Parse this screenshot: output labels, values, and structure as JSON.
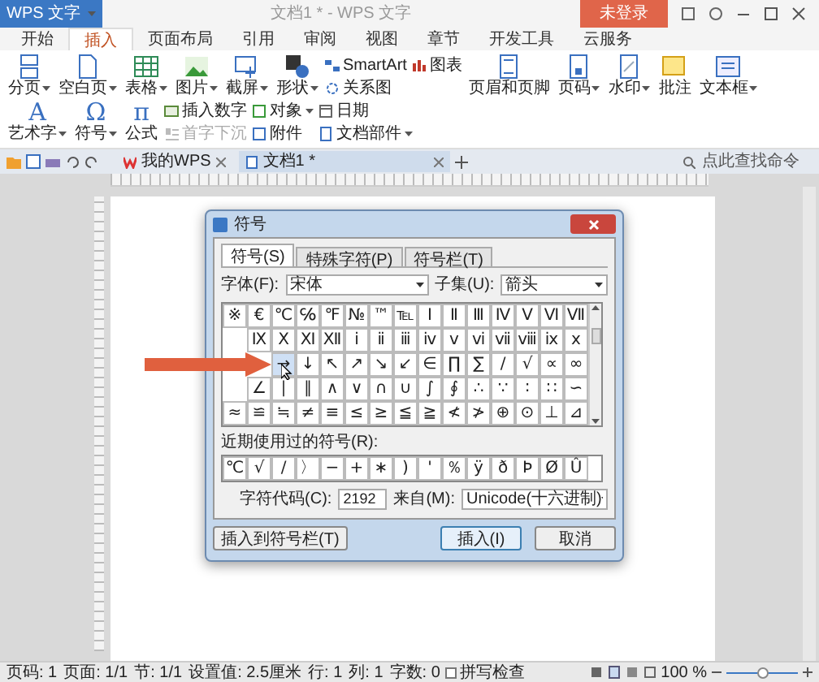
{
  "title_bar": {
    "app_menu": "WPS 文字",
    "title": "文档1 * - WPS 文字",
    "login": "未登录"
  },
  "menu_tabs": [
    {
      "label": "开始",
      "selected": false
    },
    {
      "label": "插入",
      "selected": true
    },
    {
      "label": "页面布局",
      "selected": false
    },
    {
      "label": "引用",
      "selected": false
    },
    {
      "label": "审阅",
      "selected": false
    },
    {
      "label": "视图",
      "selected": false
    },
    {
      "label": "章节",
      "selected": false
    },
    {
      "label": "开发工具",
      "selected": false
    },
    {
      "label": "云服务",
      "selected": false
    }
  ],
  "ribbon": [
    {
      "kind": "large",
      "label": "分页",
      "dropdown": true
    },
    {
      "kind": "large",
      "label": "空白页",
      "dropdown": true
    },
    {
      "kind": "large",
      "label": "表格",
      "dropdown": true
    },
    {
      "kind": "large",
      "label": "图片",
      "dropdown": true
    },
    {
      "kind": "large",
      "label": "截屏",
      "dropdown": true
    },
    {
      "kind": "large",
      "label": "形状",
      "dropdown": true
    },
    {
      "kind": "stack",
      "items": [
        {
          "label": "SmartArt",
          "dropdown": false,
          "disabled": false
        },
        {
          "label": "关系图",
          "dropdown": false,
          "disabled": false
        }
      ]
    },
    {
      "kind": "stack",
      "items": [
        {
          "label": "图表",
          "dropdown": false,
          "disabled": false
        }
      ]
    },
    {
      "kind": "large",
      "label": "页眉和页脚",
      "dropdown": false
    },
    {
      "kind": "large",
      "label": "页码",
      "dropdown": true
    },
    {
      "kind": "large",
      "label": "水印",
      "dropdown": true
    },
    {
      "kind": "large",
      "label": "批注",
      "dropdown": false
    },
    {
      "kind": "large",
      "label": "文本框",
      "dropdown": true
    },
    {
      "kind": "large",
      "label": "艺术字",
      "dropdown": true,
      "glyph": "A"
    },
    {
      "kind": "large",
      "label": "符号",
      "dropdown": true,
      "glyph": "Ω"
    },
    {
      "kind": "large",
      "label": "公式",
      "dropdown": false,
      "glyph": "π"
    },
    {
      "kind": "stack",
      "items": [
        {
          "label": "插入数字",
          "dropdown": false,
          "disabled": false
        },
        {
          "label": "首字下沉",
          "dropdown": false,
          "disabled": true
        }
      ]
    },
    {
      "kind": "stack",
      "items": [
        {
          "label": "对象",
          "dropdown": true,
          "disabled": false
        },
        {
          "label": "附件",
          "dropdown": false,
          "disabled": false
        }
      ]
    },
    {
      "kind": "stack",
      "items": [
        {
          "label": "日期",
          "dropdown": false,
          "disabled": false
        },
        {
          "label": "文档部件",
          "dropdown": true,
          "disabled": false
        }
      ]
    }
  ],
  "doc_tabs": [
    {
      "label": "我的WPS",
      "selected": false
    },
    {
      "label": "文档1 *",
      "selected": true
    }
  ],
  "command_search": {
    "placeholder": "点此查找命令"
  },
  "dialog": {
    "title": "符号",
    "tabs": [
      {
        "label": "符号(S)",
        "selected": true
      },
      {
        "label": "特殊字符(P)",
        "selected": false
      },
      {
        "label": "符号栏(T)",
        "selected": false
      }
    ],
    "font_label": "字体(F):",
    "font": "宋体",
    "subset_label": "子集(U):",
    "subset": "箭头",
    "grid": [
      [
        {
          "symbol": "※",
          "selected": false
        },
        {
          "symbol": "€",
          "selected": false
        },
        {
          "symbol": "℃",
          "selected": false
        },
        {
          "symbol": "℅",
          "selected": false
        },
        {
          "symbol": "℉",
          "selected": false
        },
        {
          "symbol": "№",
          "selected": false
        },
        {
          "symbol": "™",
          "selected": false
        },
        {
          "symbol": "℡",
          "selected": false
        },
        {
          "symbol": "Ⅰ",
          "selected": false
        },
        {
          "symbol": "Ⅱ",
          "selected": false
        },
        {
          "symbol": "Ⅲ",
          "selected": false
        },
        {
          "symbol": "Ⅳ",
          "selected": false
        },
        {
          "symbol": "Ⅴ",
          "selected": false
        },
        {
          "symbol": "Ⅵ",
          "selected": false
        },
        {
          "symbol": "Ⅶ",
          "selected": false
        }
      ],
      [
        {
          "symbol": "Ⅸ",
          "selected": false
        },
        {
          "symbol": "Ⅹ",
          "selected": false
        },
        {
          "symbol": "Ⅺ",
          "selected": false
        },
        {
          "symbol": "Ⅻ",
          "selected": false
        },
        {
          "symbol": "ⅰ",
          "selected": false
        },
        {
          "symbol": "ⅱ",
          "selected": false
        },
        {
          "symbol": "ⅲ",
          "selected": false
        },
        {
          "symbol": "ⅳ",
          "selected": false
        },
        {
          "symbol": "ⅴ",
          "selected": false
        },
        {
          "symbol": "ⅵ",
          "selected": false
        },
        {
          "symbol": "ⅶ",
          "selected": false
        },
        {
          "symbol": "ⅷ",
          "selected": false
        },
        {
          "symbol": "ⅸ",
          "selected": false
        },
        {
          "symbol": "ⅹ",
          "selected": false
        }
      ],
      [
        {
          "symbol": "→",
          "selected": true
        },
        {
          "symbol": "↓",
          "selected": false
        },
        {
          "symbol": "↖",
          "selected": false
        },
        {
          "symbol": "↗",
          "selected": false
        },
        {
          "symbol": "↘",
          "selected": false
        },
        {
          "symbol": "↙",
          "selected": false
        },
        {
          "symbol": "∈",
          "selected": false
        },
        {
          "symbol": "∏",
          "selected": false
        },
        {
          "symbol": "∑",
          "selected": false
        },
        {
          "symbol": "∕",
          "selected": false
        },
        {
          "symbol": "√",
          "selected": false
        },
        {
          "symbol": "∝",
          "selected": false
        },
        {
          "symbol": "∞",
          "selected": false
        }
      ],
      [
        {
          "symbol": "∠",
          "selected": false
        },
        {
          "symbol": "∣",
          "selected": false
        },
        {
          "symbol": "∥",
          "selected": false
        },
        {
          "symbol": "∧",
          "selected": false
        },
        {
          "symbol": "∨",
          "selected": false
        },
        {
          "symbol": "∩",
          "selected": false
        },
        {
          "symbol": "∪",
          "selected": false
        },
        {
          "symbol": "∫",
          "selected": false
        },
        {
          "symbol": "∮",
          "selected": false
        },
        {
          "symbol": "∴",
          "selected": false
        },
        {
          "symbol": "∵",
          "selected": false
        },
        {
          "symbol": "∶",
          "selected": false
        },
        {
          "symbol": "∷",
          "selected": false
        },
        {
          "symbol": "∽",
          "selected": false
        }
      ],
      [
        {
          "symbol": "≈",
          "selected": false
        },
        {
          "symbol": "≌",
          "selected": false
        },
        {
          "symbol": "≒",
          "selected": false
        },
        {
          "symbol": "≠",
          "selected": false
        },
        {
          "symbol": "≡",
          "selected": false
        },
        {
          "symbol": "≤",
          "selected": false
        },
        {
          "symbol": "≥",
          "selected": false
        },
        {
          "symbol": "≦",
          "selected": false
        },
        {
          "symbol": "≧",
          "selected": false
        },
        {
          "symbol": "≮",
          "selected": false
        },
        {
          "symbol": "≯",
          "selected": false
        },
        {
          "symbol": "⊕",
          "selected": false
        },
        {
          "symbol": "⊙",
          "selected": false
        },
        {
          "symbol": "⊥",
          "selected": false
        },
        {
          "symbol": "⊿",
          "selected": false
        }
      ]
    ],
    "recent_label": "近期使用过的符号(R):",
    "recent": [
      "℃",
      "√",
      "/",
      "〉",
      "−",
      "+",
      "∗",
      ")",
      "'",
      "％",
      "ÿ",
      "ð",
      "Þ",
      "Ø",
      "Û"
    ],
    "code_label": "字符代码(C):",
    "code": "2192",
    "from_label": "来自(M):",
    "from": "Unicode(十六进制)",
    "buttons": [
      {
        "kind": "bar",
        "label": "插入到符号栏(T)"
      },
      {
        "kind": "default",
        "label": "插入(I)"
      },
      {
        "kind": "normal",
        "label": "取消"
      }
    ]
  },
  "status_bar": {
    "items": [
      "页码: 1",
      "页面: 1/1",
      "节: 1/1",
      "设置值: 2.5厘米",
      "行: 1",
      "列: 1",
      "字数: 0"
    ],
    "spell_check": {
      "label": "拼写检查",
      "checked": false
    },
    "zoom": "100 %",
    "zoom_slider": {
      "level": 0.5
    }
  }
}
